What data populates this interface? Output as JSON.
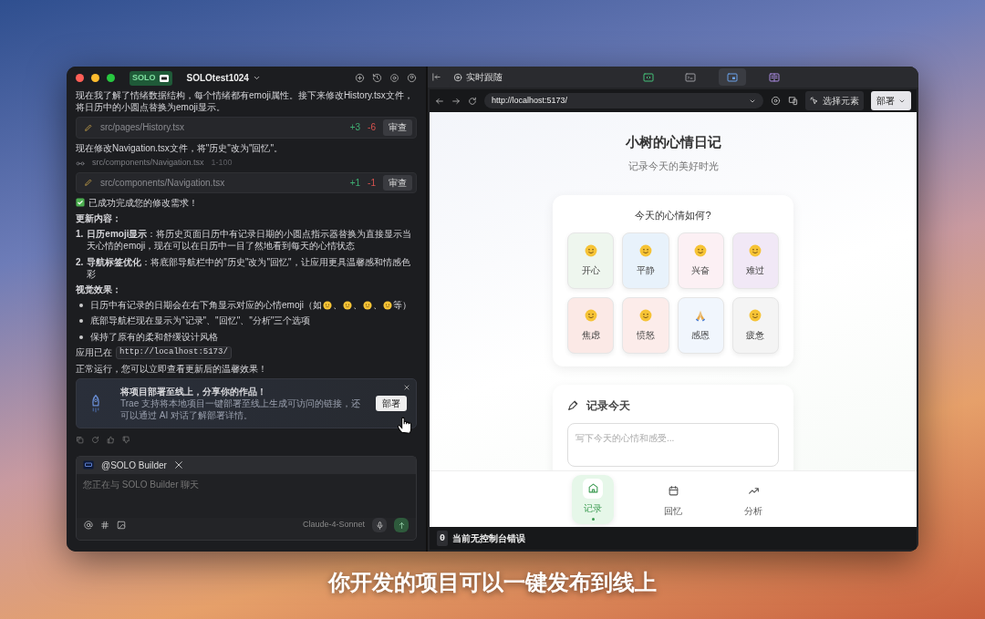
{
  "window": {
    "badge": "SOLO",
    "project": "SOLOtest1024"
  },
  "chat": [
    {
      "kind": "text",
      "text": "现在我了解了情绪数据结构，每个情绪都有emoji属性。接下来修改History.tsx文件，将日历中的小圆点替换为emoji显示。"
    },
    {
      "kind": "edit",
      "path": "src/pages/History.tsx",
      "added": "+3",
      "removed": "-6",
      "action": "审查"
    },
    {
      "kind": "text",
      "text": "现在修改Navigation.tsx文件，将\"历史\"改为\"回忆\"。"
    },
    {
      "kind": "read",
      "path": "src/components/Navigation.tsx",
      "range": "1-100"
    },
    {
      "kind": "edit",
      "path": "src/components/Navigation.tsx",
      "added": "+1",
      "removed": "-1",
      "action": "审查"
    },
    {
      "kind": "success",
      "text": "已成功完成您的修改需求！"
    },
    {
      "kind": "heading",
      "text": "更新内容："
    },
    {
      "kind": "numbered",
      "number": "1.",
      "text": "**日历emoji显示**：将历史页面日历中有记录日期的小圆点指示器替换为直接显示当天心情的emoji，现在可以在日历中一目了然地看到每天的心情状态"
    },
    {
      "kind": "numbered",
      "number": "2.",
      "text": "**导航标签优化**：将底部导航栏中的\"历史\"改为\"回忆\"，让应用更具温馨感和情感色彩"
    },
    {
      "kind": "heading",
      "text": "视觉效果："
    },
    {
      "kind": "bullet",
      "parts": [
        "日历中有记录的日期会在右下角显示对应的心情emoji（如",
        "、",
        "、",
        "、",
        "等）"
      ]
    },
    {
      "kind": "bullet",
      "parts": [
        "底部导航栏现在显示为\"记录\"、\"回忆\"、\"分析\"三个选项"
      ]
    },
    {
      "kind": "bullet",
      "parts": [
        "保持了原有的柔和舒缓设计风格"
      ]
    },
    {
      "kind": "code_line",
      "before": "应用已在",
      "code": "http://localhost:5173/",
      "after": "正常运行，您可以立即查看更新后的温馨效果！"
    },
    {
      "kind": "deploy",
      "title": "将项目部署至线上，分享你的作品！",
      "body": "Trae 支持将本地项目一键部署至线上生成可访问的链接，还可以通过 AI 对话了解部署详情。",
      "button": "部署"
    }
  ],
  "composer": {
    "mention": "@SOLO Builder",
    "placeholder": "您正在与 SOLO Builder 聊天",
    "model": "Claude-4-Sonnet"
  },
  "toolbar": {
    "follow": "实时跟随",
    "tabs": [
      {
        "kind": "code",
        "selected": false
      },
      {
        "kind": "terminal",
        "selected": false
      },
      {
        "kind": "browser",
        "selected": true
      },
      {
        "kind": "diff",
        "selected": false
      }
    ]
  },
  "browser": {
    "url": "http://localhost:5173/",
    "select_element": "选择元素",
    "deploy": "部署"
  },
  "app": {
    "title": "小树的心情日记",
    "subtitle": "记录今天的美好时光",
    "mood_card": {
      "title": "今天的心情如何?",
      "moods": [
        {
          "label": "开心",
          "kind": "face",
          "color": "#eef6ee"
        },
        {
          "label": "平静",
          "kind": "face",
          "color": "#e8f2fb"
        },
        {
          "label": "兴奋",
          "kind": "face",
          "color": "#fcf0f4"
        },
        {
          "label": "难过",
          "kind": "face",
          "color": "#f1e8f6"
        },
        {
          "label": "焦虑",
          "kind": "face",
          "color": "#fbe9e6"
        },
        {
          "label": "愤怒",
          "kind": "face",
          "color": "#fcecea"
        },
        {
          "label": "感恩",
          "kind": "hands",
          "color": "#f1f6fd"
        },
        {
          "label": "疲惫",
          "kind": "face",
          "color": "#f4f4f4"
        }
      ]
    },
    "record_card": {
      "title": "记录今天",
      "placeholder": "写下今天的心情和感受..."
    },
    "nav": [
      {
        "label": "记录",
        "kind": "home",
        "selected": true
      },
      {
        "label": "回忆",
        "kind": "calendar",
        "selected": false
      },
      {
        "label": "分析",
        "kind": "trend",
        "selected": false
      }
    ]
  },
  "console": {
    "count": "0",
    "message": "当前无控制台错误"
  },
  "caption": "你开发的项目可以一键发布到线上"
}
